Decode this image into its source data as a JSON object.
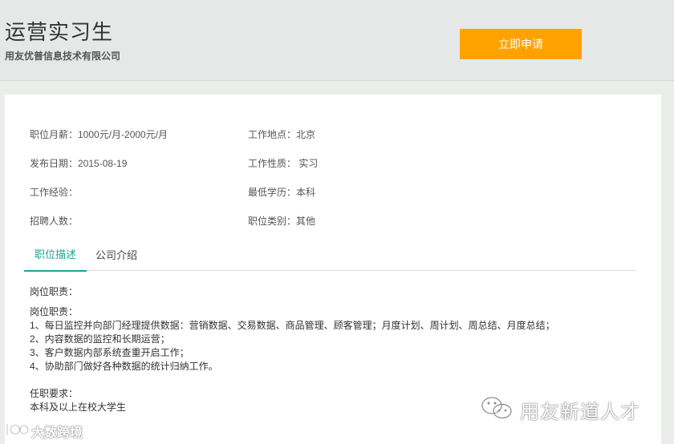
{
  "header": {
    "job_title": "运营实习生",
    "company": "用友优普信息技术有限公司",
    "apply_label": "立即申请"
  },
  "info": {
    "salary": "职位月薪：1000元/月-2000元/月",
    "location": "工作地点：北京",
    "publish_date": "发布日期：2015-08-19",
    "job_nature": "工作性质： 实习",
    "experience": "工作经验：",
    "education": "最低学历：本科",
    "headcount": "招聘人数：",
    "category": "职位类别：其他"
  },
  "tabs": {
    "description": "职位描述",
    "company_intro": "公司介绍"
  },
  "description": {
    "heading1": "岗位职责：",
    "heading2": "岗位职责：",
    "duties": [
      "1、每日监控并向部门经理提供数据：营销数据、交易数据、商品管理、顾客管理；月度计划、周计划、周总结、月度总结；",
      "2、内容数据的监控和长期运营；",
      "3、客户数据内部系统查重开启工作；",
      "4、协助部门做好各种数据的统计归纳工作。"
    ],
    "req_heading": "任职要求：",
    "req_line": "本科及以上在校大学生"
  },
  "watermarks": {
    "left": "大数跨境",
    "right": "用友新道人才"
  },
  "colors": {
    "accent": "#ffa200",
    "tab_active": "#1aa59a"
  }
}
